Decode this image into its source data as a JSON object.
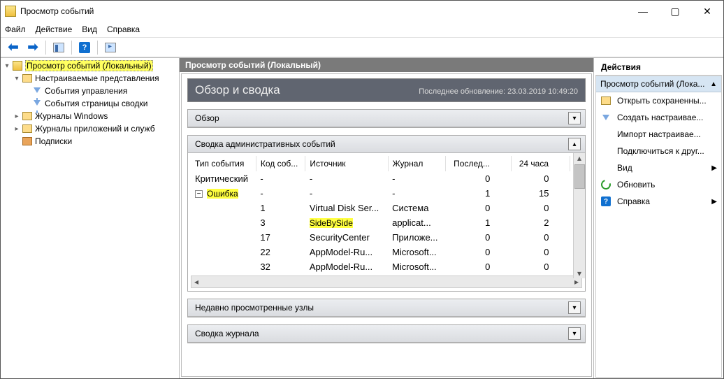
{
  "window": {
    "title": "Просмотр событий"
  },
  "menu": {
    "file": "Файл",
    "action": "Действие",
    "view": "Вид",
    "help": "Справка"
  },
  "tree": {
    "root": "Просмотр событий (Локальный)",
    "custom": "Настраиваемые представления",
    "mgmt": "События управления",
    "summary": "События страницы сводки",
    "winlogs": "Журналы Windows",
    "applogs": "Журналы приложений и служб",
    "subs": "Подписки"
  },
  "center": {
    "header": "Просмотр событий (Локальный)",
    "banner_title": "Обзор и сводка",
    "banner_ts_label": "Последнее обновление: 23.03.2019 10:49:20",
    "panel_overview": "Обзор",
    "panel_admin": "Сводка административных событий",
    "panel_recent": "Недавно просмотренные узлы",
    "panel_logsum": "Сводка журнала",
    "cols": {
      "type": "Тип события",
      "code": "Код соб...",
      "source": "Источник",
      "journal": "Журнал",
      "last": "Послед...",
      "h24": "24 часа"
    },
    "rows": [
      {
        "type": "Критический",
        "code": "-",
        "source": "-",
        "journal": "-",
        "last": "0",
        "h24": "0",
        "expander": "",
        "hl_type": false,
        "hl_source": false
      },
      {
        "type": "Ошибка",
        "code": "-",
        "source": "-",
        "journal": "-",
        "last": "1",
        "h24": "15",
        "expander": "−",
        "hl_type": true,
        "hl_source": false
      },
      {
        "type": "",
        "code": "1",
        "source": "Virtual Disk Ser...",
        "journal": "Система",
        "last": "0",
        "h24": "0",
        "expander": "",
        "hl_type": false,
        "hl_source": false
      },
      {
        "type": "",
        "code": "3",
        "source": "SideBySide",
        "journal": "applicat...",
        "last": "1",
        "h24": "2",
        "expander": "",
        "hl_type": false,
        "hl_source": true
      },
      {
        "type": "",
        "code": "17",
        "source": "SecurityCenter",
        "journal": "Приложе...",
        "last": "0",
        "h24": "0",
        "expander": "",
        "hl_type": false,
        "hl_source": false
      },
      {
        "type": "",
        "code": "22",
        "source": "AppModel-Ru...",
        "journal": "Microsoft...",
        "last": "0",
        "h24": "0",
        "expander": "",
        "hl_type": false,
        "hl_source": false
      },
      {
        "type": "",
        "code": "32",
        "source": "AppModel-Ru...",
        "journal": "Microsoft...",
        "last": "0",
        "h24": "0",
        "expander": "",
        "hl_type": false,
        "hl_source": false
      }
    ]
  },
  "actions": {
    "pane_title": "Действия",
    "header": "Просмотр событий (Лока...",
    "open_saved": "Открыть сохраненны...",
    "create_custom": "Создать настраивае...",
    "import_custom": "Импорт настраивае...",
    "connect": "Подключиться к друг...",
    "view": "Вид",
    "refresh": "Обновить",
    "help": "Справка"
  }
}
